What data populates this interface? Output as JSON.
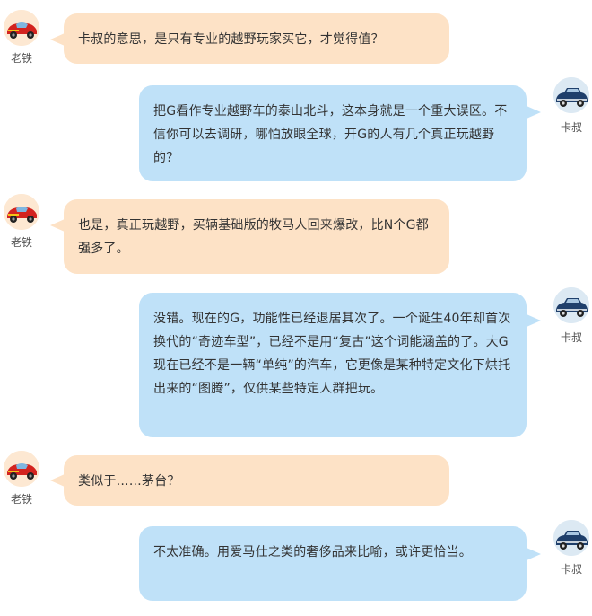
{
  "participants": {
    "left": {
      "name": "老铁",
      "avatar_icon": "red-race-car-avatar-icon",
      "bubble_color": "#fde2c6"
    },
    "right": {
      "name": "卡叔",
      "avatar_icon": "vintage-blue-car-avatar-icon",
      "bubble_color": "#bfe1f8"
    }
  },
  "messages": [
    {
      "side": "left",
      "sender": "老铁",
      "text": "卡叔的意思，是只有专业的越野玩家买它，才觉得值？"
    },
    {
      "side": "right",
      "sender": "卡叔",
      "text": "把G看作专业越野车的泰山北斗，这本身就是一个重大误区。不信你可以去调研，哪怕放眼全球，开G的人有几个真正玩越野的？"
    },
    {
      "side": "left",
      "sender": "老铁",
      "text": "也是，真正玩越野，买辆基础版的牧马人回来爆改，比N个G都强多了。"
    },
    {
      "side": "right",
      "sender": "卡叔",
      "text": "没错。现在的G，功能性已经退居其次了。一个诞生40年却首次换代的“奇迹车型”，已经不是用“复古”这个词能涵盖的了。大G现在已经不是一辆“单纯”的汽车，它更像是某种特定文化下烘托出来的“图腾”，仅供某些特定人群把玩。"
    },
    {
      "side": "left",
      "sender": "老铁",
      "text": "类似于……茅台？"
    },
    {
      "side": "right",
      "sender": "卡叔",
      "text": "不太准确。用爱马仕之类的奢侈品来比喻，或许更恰当。"
    }
  ]
}
